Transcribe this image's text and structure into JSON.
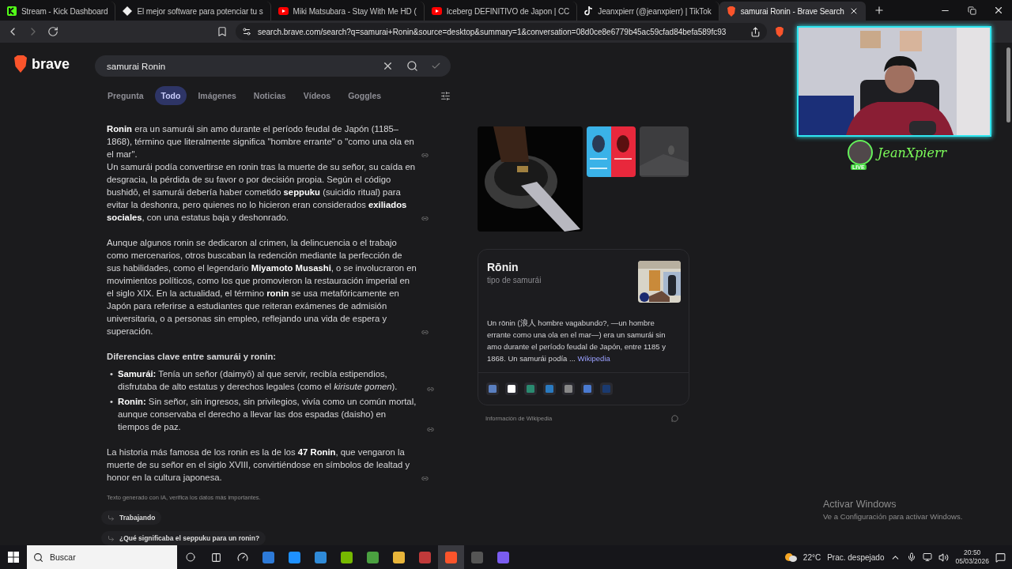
{
  "browser": {
    "tabs": [
      {
        "title": "Stream - Kick Dashboard",
        "kind": "kick",
        "selected": false
      },
      {
        "title": "El mejor software para potenciar tu s",
        "kind": "diamond",
        "selected": false
      },
      {
        "title": "Miki Matsubara - Stay With Me HD (",
        "kind": "youtube",
        "selected": false
      },
      {
        "title": "Iceberg DEFINITIVO de Japon | CC",
        "kind": "youtube",
        "selected": false
      },
      {
        "title": "Jeanxpierr (@jeanxpierr) | TikTok",
        "kind": "tiktok",
        "selected": false
      },
      {
        "title": "samurai Ronin - Brave Search",
        "kind": "brave",
        "selected": true
      }
    ],
    "address": "search.brave.com/search?q=samurai+Ronin&source=desktop&summary=1&conversation=08d0ce8e6779b45ac59cfad84befa589fc93"
  },
  "search": {
    "logo": "brave",
    "query": "samurai Ronin",
    "filters": [
      {
        "label": "Pregunta",
        "selected": false
      },
      {
        "label": "Todo",
        "selected": true
      },
      {
        "label": "Imágenes",
        "selected": false
      },
      {
        "label": "Noticias",
        "selected": false
      },
      {
        "label": "Vídeos",
        "selected": false
      },
      {
        "label": "Goggles",
        "selected": false
      }
    ]
  },
  "answer": {
    "blocks": [
      {
        "kind": "paragraph",
        "segments": [
          "**Ronin** era un samurái sin amo durante el período feudal de Japón (1185–1868), término que literalmente significa \"hombre errante\" o \"como una ola en el mar\".",
          "Un samurái podía convertirse en ronin tras la muerte de su señor, su caída en desgracia, la pérdida de su favor o por decisión propia. Según el código bushidō, el samurái debería haber cometido **seppuku** (suicidio ritual) para evitar la deshonra, pero quienes no lo hicieron eran considerados **exiliados sociales**, con una estatus baja y deshonrado."
        ]
      },
      {
        "kind": "paragraph",
        "segments": [
          "Aunque algunos ronin se dedicaron al crimen, la delincuencia o el trabajo como mercenarios, otros buscaban la redención mediante la perfección de sus habilidades, como el legendario **Miyamoto Musashi**, o se involucraron en movimientos políticos, como los que promovieron la restauración imperial en el siglo XIX. En la actualidad, el término **ronin** se usa metafóricamente en Japón para referirse a estudiantes que reiteran exámenes de admisión universitaria, o a personas sin empleo, reflejando una vida de espera y superación."
        ]
      },
      {
        "kind": "heading",
        "segments": [
          "Diferencias clave entre samurái y ronin:"
        ]
      },
      {
        "kind": "bullets",
        "marker": "•",
        "segments": [
          "**Samurái:** Tenía un señor (daimyō) al que servir, recibía estipendios, disfrutaba de alto estatus y derechos legales (como el *kirisute gomen*).",
          "**Ronin:** Sin señor, sin ingresos, sin privilegios, vivía como un común mortal, aunque conservaba el derecho a llevar las dos espadas (daisho) en tiempos de paz."
        ]
      },
      {
        "kind": "paragraph",
        "segments": [
          "La historia más famosa de los ronin es la de los **47 Ronin**, que vengaron la muerte de su señor en el siglo XVIII, convirtiéndose en símbolos de lealtad y honor en la cultura japonesa."
        ]
      }
    ],
    "disclaimer": "Texto generado con IA, verifica los datos más importantes.",
    "followups": [
      "Trabajando",
      "¿Qué significaba el seppuku para un ronin?"
    ]
  },
  "knowledge": {
    "title": "Rōnin",
    "subtitle": "tipo de samurái",
    "description": "Un rōnin (浪人 hombre vagabundo?, —un hombre errante como una ola en el mar—) era un samurái sin amo durante el período feudal de Japón, entre 1185 y 1868. Un samurái podía ...",
    "link": "Wikipedia",
    "source": "Información de Wikipedia"
  },
  "stream_overlay": {
    "name": "JeanXpierr",
    "badge": "LIVE"
  },
  "windows_notice": {
    "title": "Activar Windows",
    "text": "Ve a Configuración para activar Windows."
  },
  "taskbar": {
    "search_placeholder": "Buscar",
    "temperature": "22°C",
    "condition": "Prac. despejado",
    "time": "20:50",
    "date": "05/03/2026"
  }
}
